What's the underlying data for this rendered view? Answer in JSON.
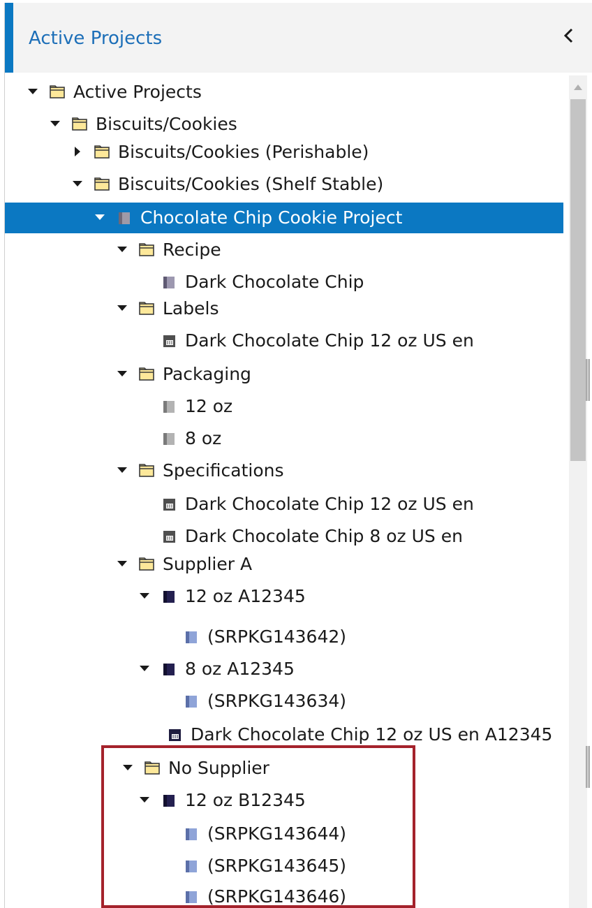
{
  "header": {
    "title": "Active Projects",
    "collapse_icon": "chevron-left-icon"
  },
  "tree": {
    "rows": [
      {
        "label": "Active Projects",
        "depth": 0,
        "toggle": "expanded",
        "icon": "folder"
      },
      {
        "label": "Biscuits/Cookies",
        "depth": 1,
        "toggle": "expanded",
        "icon": "folder"
      },
      {
        "label": "Biscuits/Cookies (Perishable)",
        "depth": 2,
        "toggle": "collapsed",
        "icon": "folder"
      },
      {
        "label": "Biscuits/Cookies (Shelf Stable)",
        "depth": 2,
        "toggle": "expanded",
        "icon": "folder"
      },
      {
        "label": "Chocolate Chip Cookie Project",
        "depth": 3,
        "toggle": "expanded",
        "icon": "project-cube",
        "selected": true
      },
      {
        "label": "Recipe",
        "depth": 4,
        "toggle": "expanded",
        "icon": "folder"
      },
      {
        "label": "Dark Chocolate Chip",
        "depth": 5,
        "toggle": "none",
        "icon": "recipe-cube"
      },
      {
        "label": "Labels",
        "depth": 4,
        "toggle": "expanded",
        "icon": "folder"
      },
      {
        "label": "Dark Chocolate Chip 12 oz US en",
        "depth": 5,
        "toggle": "none",
        "icon": "label-doc"
      },
      {
        "label": "Packaging",
        "depth": 4,
        "toggle": "expanded",
        "icon": "folder"
      },
      {
        "label": "12 oz",
        "depth": 5,
        "toggle": "none",
        "icon": "package-cube"
      },
      {
        "label": "8 oz",
        "depth": 5,
        "toggle": "none",
        "icon": "package-cube"
      },
      {
        "label": "Specifications",
        "depth": 4,
        "toggle": "expanded",
        "icon": "folder"
      },
      {
        "label": "Dark Chocolate Chip 12 oz US en",
        "depth": 5,
        "toggle": "none",
        "icon": "label-doc"
      },
      {
        "label": "Dark Chocolate Chip 8 oz US en",
        "depth": 5,
        "toggle": "none",
        "icon": "label-doc"
      },
      {
        "label": "Supplier A",
        "depth": 4,
        "toggle": "expanded",
        "icon": "folder"
      },
      {
        "label": "12 oz A12345",
        "depth": 5,
        "toggle": "expanded",
        "icon": "supplier-cube"
      },
      {
        "label": "(SRPKG143642)",
        "depth": 6,
        "toggle": "none",
        "icon": "component-cube"
      },
      {
        "label": "8 oz A12345",
        "depth": 5,
        "toggle": "expanded",
        "icon": "supplier-cube"
      },
      {
        "label": "(SRPKG143634)",
        "depth": 6,
        "toggle": "none",
        "icon": "component-cube"
      },
      {
        "label": "Dark Chocolate Chip 12 oz US en A12345",
        "depth": 5,
        "toggle": "none",
        "icon": "supplier-doc"
      },
      {
        "label": "No Supplier",
        "depth": 4,
        "toggle": "expanded",
        "icon": "folder"
      },
      {
        "label": "12 oz B12345",
        "depth": 5,
        "toggle": "expanded",
        "icon": "supplier-cube"
      },
      {
        "label": "(SRPKG143644)",
        "depth": 6,
        "toggle": "none",
        "icon": "component-cube"
      },
      {
        "label": "(SRPKG143645)",
        "depth": 6,
        "toggle": "none",
        "icon": "component-cube"
      },
      {
        "label": "(SRPKG143646)",
        "depth": 6,
        "toggle": "none",
        "icon": "component-cube"
      }
    ]
  },
  "colors": {
    "accent": "#0b78c2",
    "selected_bg": "#0b78c2",
    "highlight_border": "#a4222b",
    "folder_fill": "#fde89a",
    "folder_stroke": "#3a3a3a"
  }
}
